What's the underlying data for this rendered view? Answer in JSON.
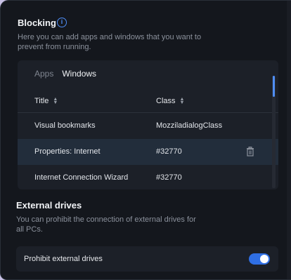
{
  "blocking": {
    "title": "Blocking",
    "info_icon": "i",
    "description_line1": "Here you can add apps and windows that you want to",
    "description_line2": "prevent from running."
  },
  "tabs": [
    {
      "label": "Apps",
      "active": false
    },
    {
      "label": "Windows",
      "active": true
    }
  ],
  "table": {
    "columns": [
      "Title",
      "Class"
    ],
    "rows": [
      {
        "title": "Visual bookmarks",
        "class": "MozziladialogClass",
        "selected": false
      },
      {
        "title": "Properties: Internet",
        "class": "#32770",
        "selected": true
      },
      {
        "title": "Internet Connection Wizard",
        "class": "#32770",
        "selected": false
      }
    ]
  },
  "external_drives": {
    "title": "External drives",
    "description_line1": "You can prohibit the connection of external drives for",
    "description_line2": "all PCs.",
    "toggle_label": "Prohibit external drives",
    "toggle_on": true
  },
  "colors": {
    "accent": "#2f6fe4",
    "background": "#14171d",
    "panel": "#1c2028",
    "selected_row": "#222d3b"
  }
}
